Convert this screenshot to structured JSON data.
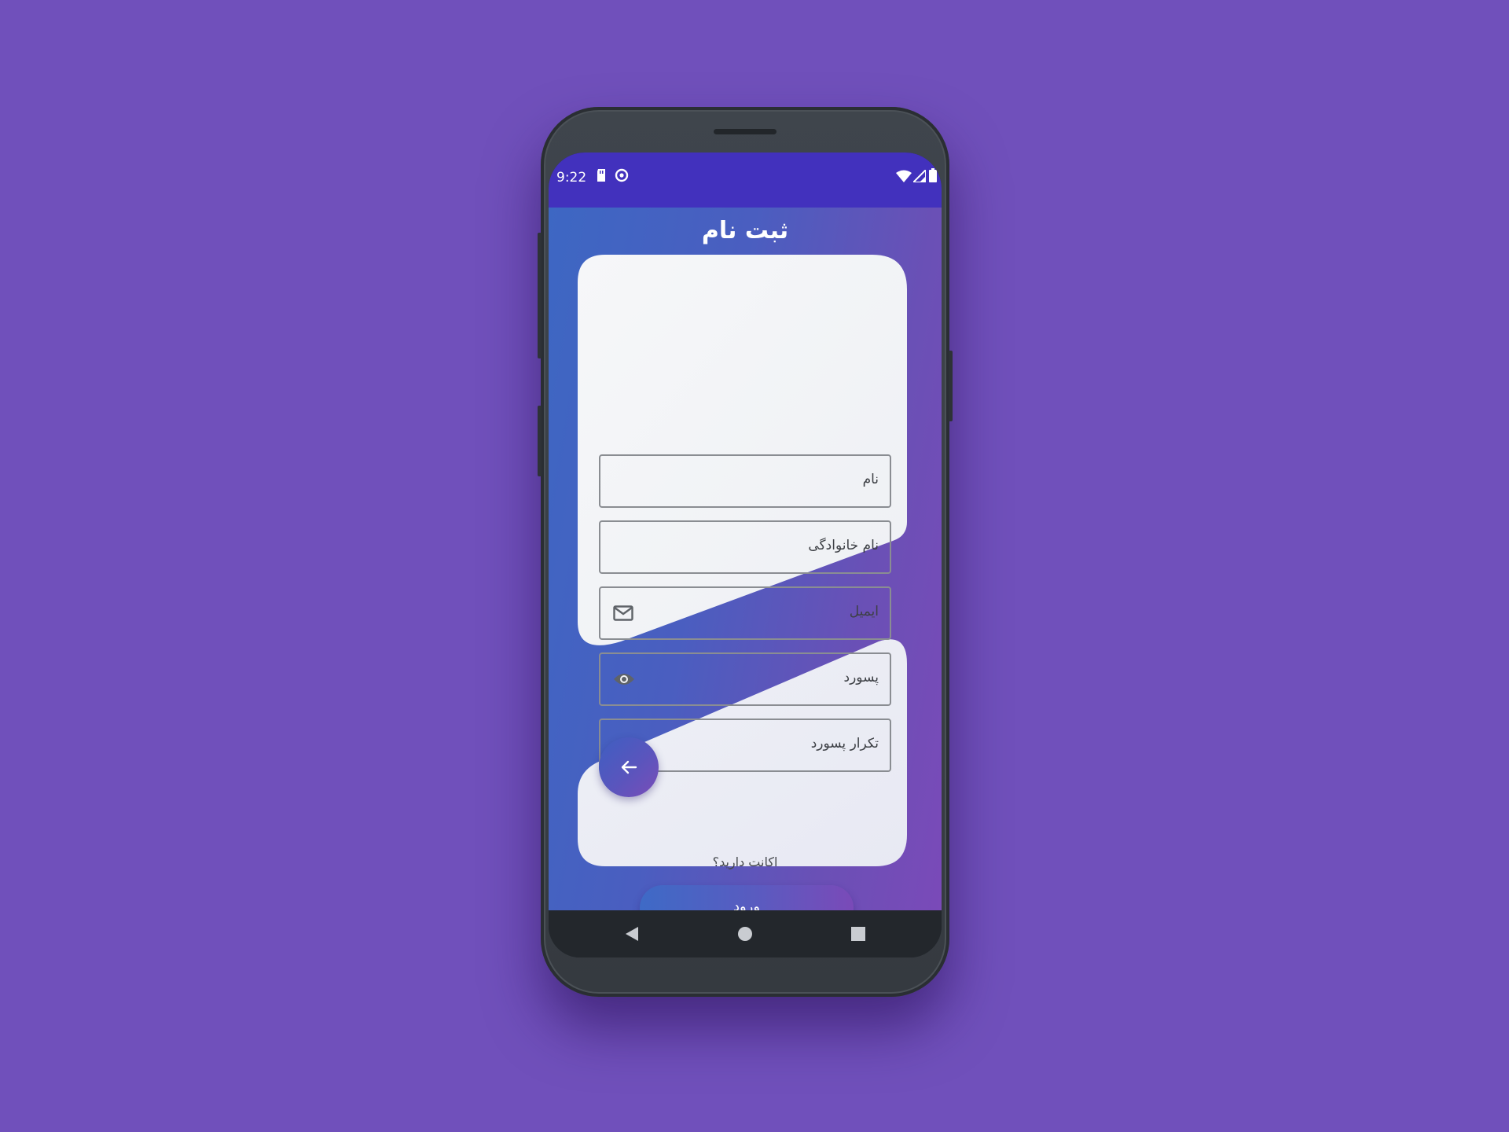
{
  "status_bar": {
    "time": "9:22",
    "left_icons": [
      "sd-card-icon",
      "data-saver-icon"
    ],
    "right_icons": [
      "wifi-icon",
      "cell-signal-icon",
      "battery-icon"
    ],
    "color": "#4231bd"
  },
  "screen": {
    "title": "ثبت نام",
    "gradient": [
      "#3d67c3",
      "#7a4ab8"
    ]
  },
  "form": {
    "first_name": {
      "placeholder": "نام"
    },
    "last_name": {
      "placeholder": "نام خانوادگی"
    },
    "email": {
      "placeholder": "ایمیل",
      "icon": "mail-icon"
    },
    "password": {
      "placeholder": "پسورد",
      "icon": "eye-icon"
    },
    "confirm_password": {
      "placeholder": "تکرار پسورد",
      "icon": "eye-icon"
    },
    "submit_icon": "arrow-left-icon"
  },
  "login_section": {
    "question": "اکانت دارید؟",
    "button_label": "ورود"
  },
  "nav_bar": {
    "items": [
      "back-triangle-icon",
      "home-circle-icon",
      "recents-square-icon"
    ]
  }
}
